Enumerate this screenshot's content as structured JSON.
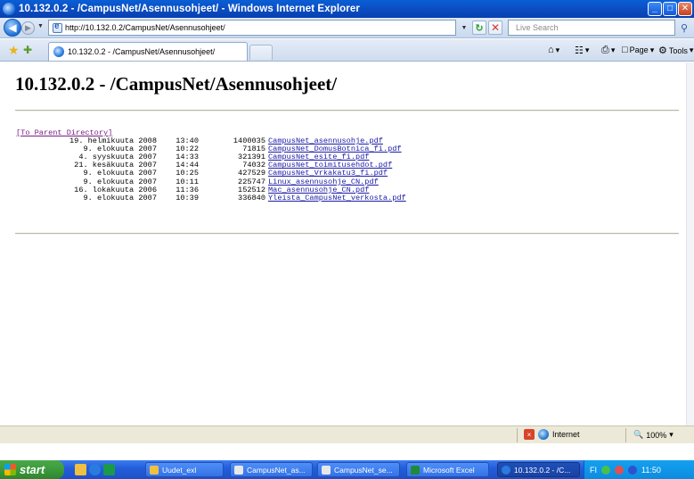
{
  "window": {
    "title": "10.132.0.2 - /CampusNet/Asennusohjeet/ - Windows Internet Explorer",
    "buttons": {
      "minimize": "_",
      "maximize": "□",
      "close": "✕"
    }
  },
  "address_bar": {
    "url": "http://10.132.0.2/CampusNet/Asennusohjeet/",
    "search_placeholder": "Live Search"
  },
  "tabs": [
    {
      "label": "10.132.0.2 - /CampusNet/Asennusohjeet/"
    }
  ],
  "command_bar": {
    "page_label": "Page",
    "tools_label": "Tools"
  },
  "page": {
    "heading": "10.132.0.2 - /CampusNet/Asennusohjeet/",
    "parent_link": "[To Parent Directory]",
    "files": [
      {
        "date": "19. helmikuuta 2008",
        "time": "13:40",
        "size": "1400035",
        "name": "CampusNet_asennusohje.pdf"
      },
      {
        "date": "9. elokuuta 2007",
        "time": "10:22",
        "size": "71815",
        "name": "CampusNet_DomusBotnica_fi.pdf"
      },
      {
        "date": "4. syyskuuta 2007",
        "time": "14:33",
        "size": "321391",
        "name": "CampusNet_esite_fi.pdf"
      },
      {
        "date": "21. kesäkuuta 2007",
        "time": "14:44",
        "size": "74032",
        "name": "CampusNet_toimitusehdot.pdf"
      },
      {
        "date": "9. elokuuta 2007",
        "time": "10:25",
        "size": "427529",
        "name": "CampusNet_Vrkakatu3_fi.pdf"
      },
      {
        "date": "9. elokuuta 2007",
        "time": "10:11",
        "size": "225747",
        "name": "Linux_asennusohje_CN.pdf"
      },
      {
        "date": "16. lokakuuta 2006",
        "time": "11:36",
        "size": "152512",
        "name": "Mac_asennusohje_CN.pdf"
      },
      {
        "date": "9. elokuuta 2007",
        "time": "10:39",
        "size": "336840",
        "name": "Yleista_CampusNet_verkosta.pdf"
      }
    ]
  },
  "status_bar": {
    "zone": "Internet",
    "zoom": "100%"
  },
  "taskbar": {
    "start_label": "start",
    "tasks": [
      {
        "label": "Uudet_exl"
      },
      {
        "label": "CampusNet_as..."
      },
      {
        "label": "CampusNet_se..."
      },
      {
        "label": "Microsoft Excel"
      },
      {
        "label": "10.132.0.2 - /C..."
      }
    ],
    "tray": {
      "lang": "FI",
      "time": "11:50"
    }
  }
}
